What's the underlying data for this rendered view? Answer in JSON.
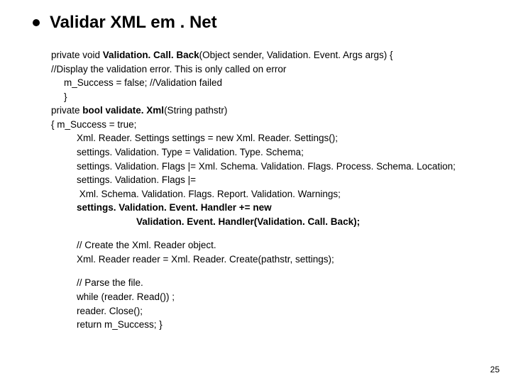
{
  "title": "Validar XML em . Net",
  "code1": {
    "l1a": "private void ",
    "l1b": "Validation. Call. Back",
    "l1c": "(Object sender, Validation. Event. Args args) {",
    "l2": "//Display the validation error.  This is only called on error",
    "l3": "m_Success = false; //Validation failed",
    "l4": "}",
    "l5a": " private ",
    "l5b": "bool validate. Xml",
    "l5c": "(String pathstr)",
    "l6": " {    m_Success = true;",
    "l7": "Xml. Reader. Settings settings = new Xml. Reader. Settings();",
    "l8": "settings. Validation. Type = Validation. Type. Schema;",
    "l9": "settings. Validation. Flags |= Xml. Schema. Validation. Flags. Process. Schema. Location;",
    "l10": "settings. Validation. Flags |=",
    "l11": "Xml. Schema. Validation. Flags. Report. Validation. Warnings;",
    "l12": "settings. Validation. Event. Handler += new",
    "l13": "Validation. Event. Handler(Validation. Call. Back);"
  },
  "code2": {
    "l1": "// Create the Xml. Reader object.",
    "l2": "Xml. Reader reader = Xml. Reader. Create(pathstr, settings);"
  },
  "code3": {
    "l1": "// Parse the file.",
    "l2": "while (reader. Read()) ;",
    "l3": "reader. Close();",
    "l4": "return m_Success; }"
  },
  "pagenum": "25"
}
